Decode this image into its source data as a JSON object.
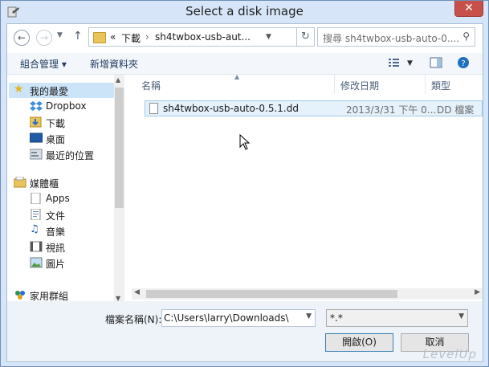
{
  "window": {
    "title": "Select a disk image",
    "close_glyph": "✕"
  },
  "address": {
    "path_prefix": "«",
    "segments": [
      "下載",
      "sh4twbox-usb-aut..."
    ],
    "separator": "›",
    "search_placeholder": "搜尋 sh4twbox-usb-auto-0...."
  },
  "toolbar": {
    "organize": "組合管理 ▾",
    "new_folder": "新增資料夾"
  },
  "nav": {
    "favorites": {
      "label": "我的最愛",
      "items": [
        "Dropbox",
        "下載",
        "桌面",
        "最近的位置"
      ]
    },
    "libraries": {
      "label": "媒體櫃",
      "items": [
        "Apps",
        "文件",
        "音樂",
        "視訊",
        "圖片"
      ]
    },
    "homegroup": {
      "label": "家用群組"
    }
  },
  "columns": {
    "name": "名稱",
    "modified": "修改日期",
    "type": "類型"
  },
  "files": [
    {
      "name": "sh4twbox-usb-auto-0.5.1.dd",
      "modified": "2013/3/31 下午 0...",
      "type": "DD 檔案"
    }
  ],
  "filename_label": "檔案名稱(N):",
  "filename_value": "C:\\Users\\larry\\Downloads\\",
  "filter_value": "*.*",
  "open_button": "開啟(O)",
  "cancel_button": "取消",
  "watermark": "LevelUp",
  "colors": {
    "accent": "#3c7fb1",
    "selection": "#e5f1fb",
    "frame": "#d6e6f8"
  }
}
